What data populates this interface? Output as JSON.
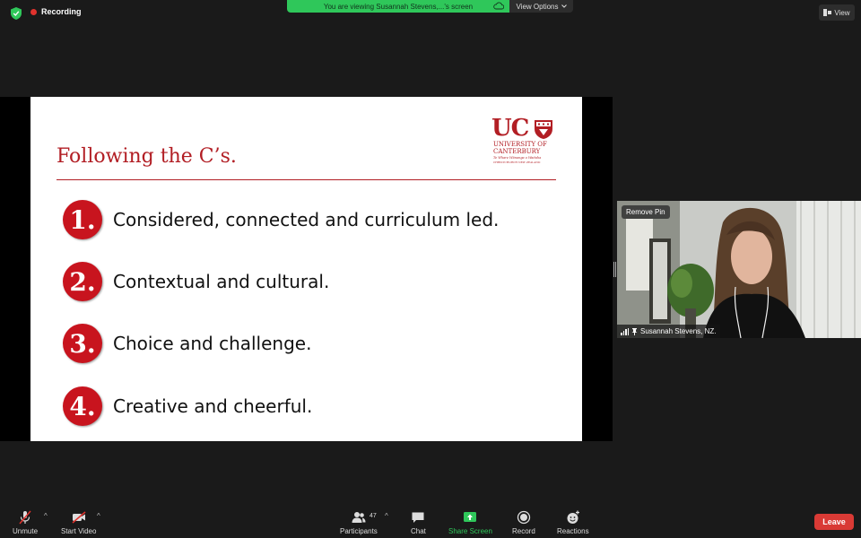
{
  "status": {
    "recording_label": "Recording"
  },
  "banner": {
    "text": "You are viewing Susannah Stevens,...'s screen",
    "view_options_label": "View Options"
  },
  "view_button": {
    "label": "View"
  },
  "slide": {
    "title": "Following the C’s.",
    "logo": {
      "letters": "UC",
      "line1": "UNIVERSITY OF",
      "line2": "CANTERBURY",
      "line3": "Te Whare Wānanga o Waitaha",
      "line4": "CHRISTCHURCH NEW ZEALAND"
    },
    "points": [
      {
        "number": "1.",
        "text": "Considered, connected and curriculum led."
      },
      {
        "number": "2.",
        "text": "Contextual and cultural."
      },
      {
        "number": "3.",
        "text": "Choice and challenge."
      },
      {
        "number": "4.",
        "text": "Creative and cheerful."
      }
    ]
  },
  "video": {
    "remove_pin_label": "Remove Pin",
    "participant_name": "Susannah Stevens, NZ."
  },
  "toolbar": {
    "unmute": "Unmute",
    "start_video": "Start Video",
    "participants": "Participants",
    "participant_count": "47",
    "chat": "Chat",
    "share_screen": "Share Screen",
    "record": "Record",
    "reactions": "Reactions",
    "leave": "Leave"
  },
  "colors": {
    "accent_green": "#2fc75a",
    "leave_red": "#d93a35",
    "slide_red": "#b21e24"
  }
}
